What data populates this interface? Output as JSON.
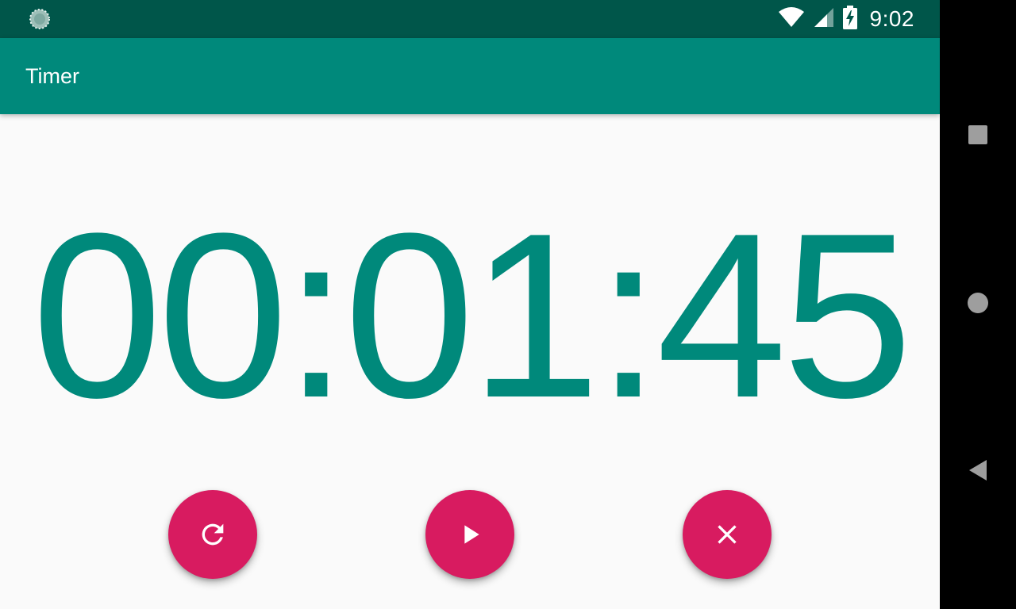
{
  "status_bar": {
    "time": "9:02",
    "background": "#00564a",
    "icons": [
      "sync-icon",
      "wifi-icon",
      "cell-signal-icon",
      "battery-charging-icon"
    ]
  },
  "app_bar": {
    "title": "Timer",
    "background": "#00897b"
  },
  "timer": {
    "display": "00:01:45",
    "color": "#00897b"
  },
  "actions": {
    "accent": "#d81b60",
    "buttons": [
      {
        "icon": "refresh-icon"
      },
      {
        "icon": "play-icon"
      },
      {
        "icon": "close-icon"
      }
    ]
  },
  "nav_bar": {
    "buttons": [
      "recents-icon",
      "home-icon",
      "back-icon"
    ]
  }
}
